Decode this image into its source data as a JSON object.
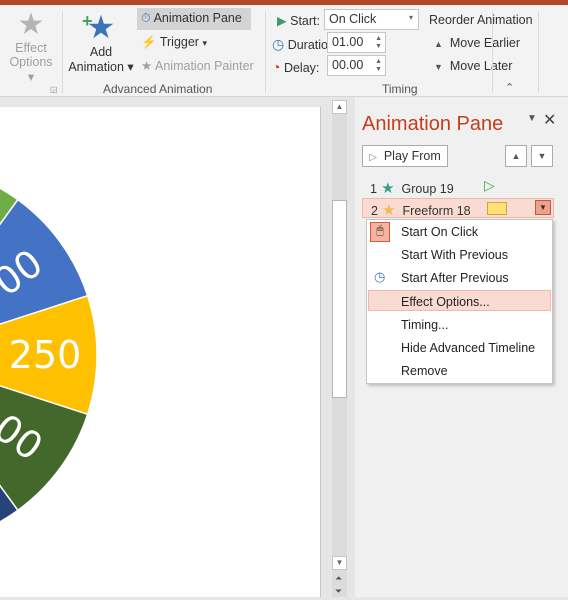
{
  "ribbon": {
    "effect_options": {
      "line1": "Effect",
      "line2": "Options"
    },
    "add_animation": {
      "line1": "Add",
      "line2": "Animation"
    },
    "animation_pane": "Animation Pane",
    "trigger": "Trigger",
    "animation_painter": "Animation Painter",
    "group_advanced": "Advanced Animation",
    "start_label": "Start:",
    "start_value": "On Click",
    "duration_label": "Duration:",
    "duration_value": "01.00",
    "delay_label": "Delay:",
    "delay_value": "00.00",
    "group_timing": "Timing",
    "reorder": "Reorder Animation",
    "move_earlier": "Move Earlier",
    "move_later": "Move Later"
  },
  "slide": {
    "labels": [
      "00",
      "250",
      "00"
    ],
    "colors": {
      "blue": "#4472c4",
      "yellow": "#ffc000",
      "green": "#43682b",
      "lightgreen": "#70ad47",
      "navy": "#264478"
    }
  },
  "pane": {
    "title": "Animation Pane",
    "play_from": "Play From",
    "items": [
      {
        "num": "1",
        "name": "Group 19",
        "star_color": "#3d9b86"
      },
      {
        "num": "2",
        "name": "Freeform 18",
        "star_color": "#f2b84b"
      }
    ],
    "menu": [
      "Start On Click",
      "Start With Previous",
      "Start After Previous",
      "Effect Options...",
      "Timing...",
      "Hide Advanced Timeline",
      "Remove"
    ]
  },
  "colors": {
    "accent": "#c43e1c",
    "highlight": "#fadbd2"
  }
}
